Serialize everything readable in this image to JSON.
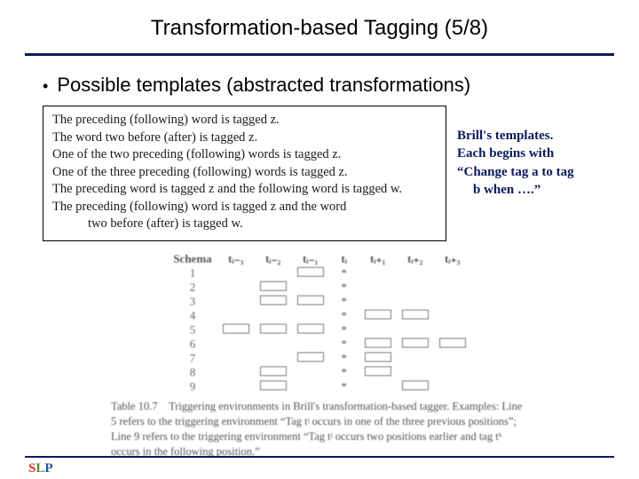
{
  "title": "Transformation-based Tagging (5/8)",
  "bullet": "Possible templates (abstracted transformations)",
  "templates": {
    "l1": "The preceding (following) word is tagged z.",
    "l2": "The word two before (after) is tagged z.",
    "l3": "One of the two preceding (following) words is tagged z.",
    "l4": "One of the three preceding (following) words is tagged z.",
    "l5": "The preceding word is tagged z and the following word is tagged w.",
    "l6": "The preceding (following) word is tagged z and the word",
    "l7": "two before (after) is tagged w."
  },
  "sidenote": {
    "l1": "Brill's templates.",
    "l2": "Each begins with",
    "l3": "“Change tag a to tag",
    "l4": "b when ….”"
  },
  "table": {
    "headers": {
      "schema": "Schema",
      "c1": "tᵢ₋₃",
      "c2": "tᵢ₋₂",
      "c3": "tᵢ₋₁",
      "c4": "tᵢ",
      "c5": "tᵢ₊₁",
      "c6": "tᵢ₊₂",
      "c7": "tᵢ₊₃"
    },
    "rows": [
      "1",
      "2",
      "3",
      "4",
      "5",
      "6",
      "7",
      "8",
      "9"
    ],
    "caption": "Table 10.7 Triggering environments in Brill's transformation-based tagger. Examples: Line 5 refers to the triggering environment “Tag tʲ occurs in one of the three previous positions”; Line 9 refers to the triggering environment “Tag tʲ occurs two positions earlier and tag tᵏ occurs in the following position.”"
  },
  "logo": {
    "a": "S",
    "b": "L",
    "c": "P"
  },
  "chart_data": {
    "type": "table",
    "title": "Triggering environments schema",
    "columns": [
      "t_i-3",
      "t_i-2",
      "t_i-1",
      "t_i",
      "t_i+1",
      "t_i+2",
      "t_i+3"
    ],
    "rows": [
      {
        "schema": 1,
        "cells": [
          0,
          0,
          1,
          "*",
          0,
          0,
          0
        ]
      },
      {
        "schema": 2,
        "cells": [
          0,
          1,
          0,
          "*",
          0,
          0,
          0
        ]
      },
      {
        "schema": 3,
        "cells": [
          0,
          1,
          1,
          "*",
          0,
          0,
          0
        ]
      },
      {
        "schema": 4,
        "cells": [
          0,
          0,
          0,
          "*",
          1,
          1,
          0
        ]
      },
      {
        "schema": 5,
        "cells": [
          1,
          1,
          1,
          "*",
          0,
          0,
          0
        ]
      },
      {
        "schema": 6,
        "cells": [
          0,
          0,
          0,
          "*",
          1,
          1,
          1
        ]
      },
      {
        "schema": 7,
        "cells": [
          0,
          0,
          1,
          "*",
          1,
          0,
          0
        ]
      },
      {
        "schema": 8,
        "cells": [
          0,
          1,
          0,
          "*",
          1,
          0,
          0
        ]
      },
      {
        "schema": 9,
        "cells": [
          0,
          1,
          0,
          "*",
          0,
          1,
          0
        ]
      }
    ],
    "legend": {
      "0": "empty",
      "1": "marked box",
      "*": "current word"
    }
  }
}
